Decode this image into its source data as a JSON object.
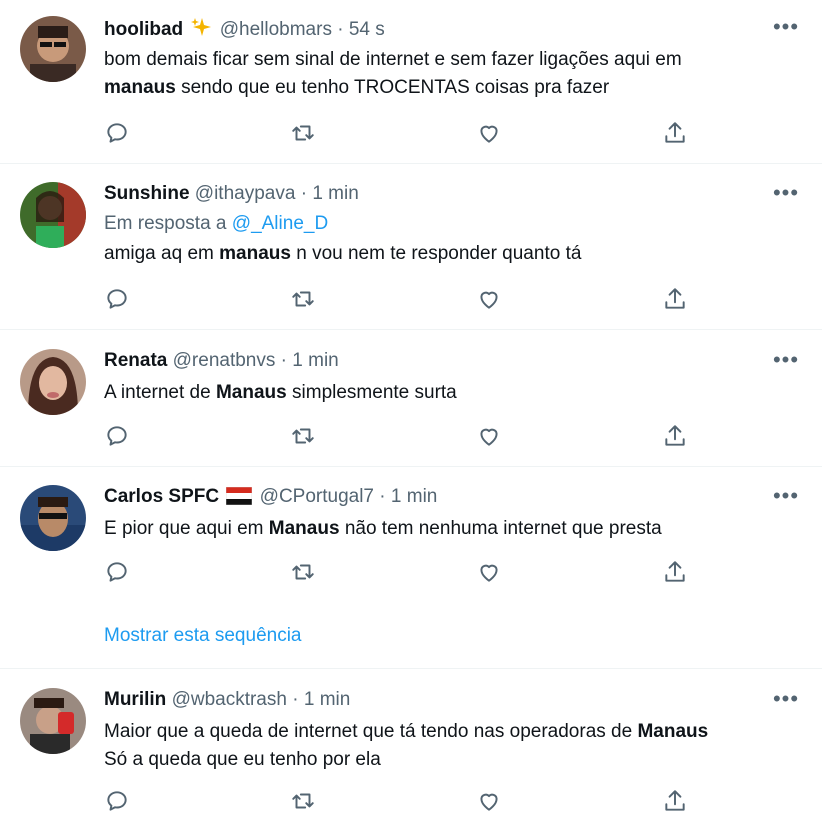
{
  "tweets": [
    {
      "name": "hoolibad",
      "handle": "@hellobmars",
      "sep": "·",
      "time": "54 s",
      "text_parts": [
        "bom demais ficar sem sinal de internet e sem fazer ligações aqui em",
        "manaus",
        "sendo que eu tenho TROCENTAS coisas pra fazer"
      ]
    },
    {
      "name": "Sunshine",
      "handle": "@ithaypava",
      "sep": "·",
      "time": "1 min",
      "reply_prefix": "Em resposta a",
      "reply_to": "@_Aline_D",
      "text_parts": [
        "amiga aq em",
        "manaus",
        "n vou nem te responder quanto tá"
      ]
    },
    {
      "name": "Renata",
      "handle": "@renatbnvs",
      "sep": "·",
      "time": "1 min",
      "text_parts": [
        "A internet de",
        "Manaus",
        "simplesmente surta"
      ]
    },
    {
      "name": "Carlos SPFC",
      "handle": "@CPortugal7",
      "sep": "·",
      "time": "1 min",
      "text_parts": [
        "E pior que aqui em",
        "Manaus",
        "não tem nenhuma internet que presta"
      ],
      "show_thread": "Mostrar esta sequência"
    },
    {
      "name": "Murilin",
      "handle": "@wbacktrash",
      "sep": "·",
      "time": "1 min",
      "text_parts": [
        "Maior que a queda de internet que tá tendo nas operadoras de",
        "Manaus",
        "Só a queda que eu tenho por ela"
      ]
    }
  ],
  "icons": {
    "more": "more-icon",
    "reply": "reply-icon",
    "retweet": "retweet-icon",
    "like": "like-icon",
    "share": "share-icon"
  },
  "colors": {
    "link": "#1d9bf0",
    "muted": "#536471",
    "divider": "#eff3f4"
  }
}
